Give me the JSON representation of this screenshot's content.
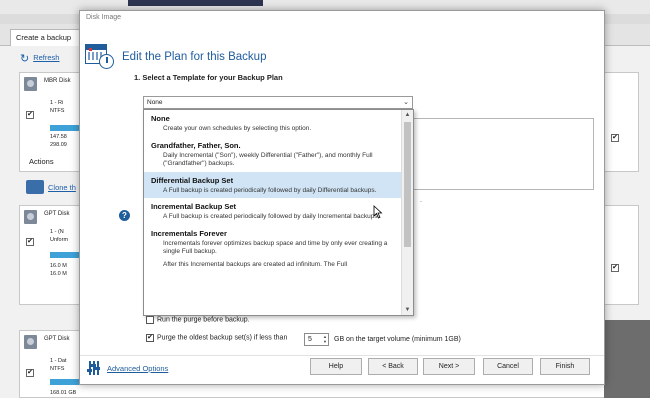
{
  "background_app": {
    "tab_label": "Create a backup",
    "refresh_label": "Refresh",
    "actions_label": "Actions",
    "clone_label": "Clone th",
    "disks": [
      {
        "title": "MBR Disk",
        "part": "1 - Ri",
        "fs": "NTFS",
        "size1": "147.58",
        "size2": "298.09"
      },
      {
        "title": "GPT Disk",
        "part": "1 - (N",
        "fs": "Unform",
        "size1": "16.0 M",
        "size2": "16.0 M"
      },
      {
        "title": "GPT Disk",
        "part": "1 - Dat",
        "fs": "NTFS",
        "size1": "168.01 GB",
        "size2": ""
      }
    ]
  },
  "dialog": {
    "window_title": "Disk Image",
    "heading": "Edit the Plan for this Backup",
    "step_label": "1. Select a Template for your Backup Plan",
    "template_select": {
      "value": "None"
    },
    "help_icon": "?",
    "templates": [
      {
        "name": "None",
        "description": "Create your own schedules by selecting this option."
      },
      {
        "name": "Grandfather, Father, Son.",
        "description": "Daily Incremental (\"Son\"), weekly Differential (\"Father\"), and monthly Full (\"Grandfather\") backups."
      },
      {
        "name": "Differential Backup Set",
        "description": "A Full backup is created periodically followed by daily Differential backups."
      },
      {
        "name": "Incremental Backup Set",
        "description": "A Full backup is created periodically followed by daily Incremental backups."
      },
      {
        "name": "Incrementals Forever",
        "description": "Incrementals forever optimizes backup space and time by only ever creating a single Full backup."
      },
      {
        "name": "",
        "description": "After this Incremental backups are created ad infinitum. The Full"
      }
    ],
    "selected_template_index": 2,
    "options": {
      "run_purge_label": "Run the purge before backup.",
      "run_purge_checked": false,
      "purge_oldest_label": "Purge the oldest backup set(s) if less than",
      "purge_oldest_checked": true,
      "purge_value": "5",
      "purge_suffix": "GB on the target volume (minimum 1GB)"
    },
    "advanced_options_label": "Advanced Options",
    "buttons": {
      "help": "Help",
      "back": "< Back",
      "next": "Next >",
      "cancel": "Cancel",
      "finish": "Finish"
    }
  },
  "colors": {
    "accent": "#1e5c9c",
    "selection": "#d0e4f5",
    "progress": "#3ea2d8"
  }
}
